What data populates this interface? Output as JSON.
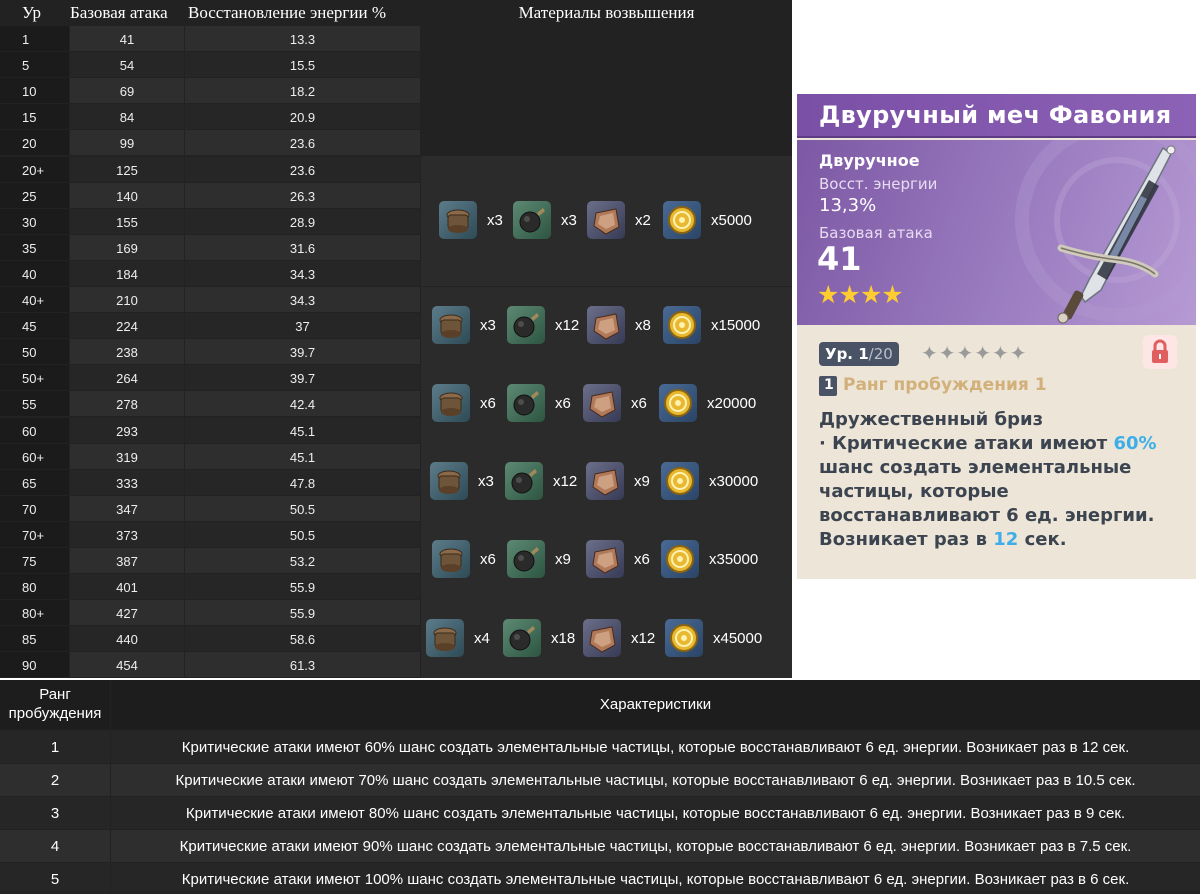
{
  "level_table": {
    "headers": {
      "level": "Ур",
      "base_atk": "Базовая атака",
      "energy": "Восстановление энергии %",
      "materials": "Материалы возвышения"
    },
    "rows": [
      {
        "level": "1",
        "atk": "41",
        "er": "13.3"
      },
      {
        "level": "5",
        "atk": "54",
        "er": "15.5"
      },
      {
        "level": "10",
        "atk": "69",
        "er": "18.2"
      },
      {
        "level": "15",
        "atk": "84",
        "er": "20.9"
      },
      {
        "level": "20",
        "atk": "99",
        "er": "23.6"
      },
      {
        "level": "20+",
        "atk": "125",
        "er": "23.6"
      },
      {
        "level": "25",
        "atk": "140",
        "er": "26.3"
      },
      {
        "level": "30",
        "atk": "155",
        "er": "28.9"
      },
      {
        "level": "35",
        "atk": "169",
        "er": "31.6"
      },
      {
        "level": "40",
        "atk": "184",
        "er": "34.3"
      },
      {
        "level": "40+",
        "atk": "210",
        "er": "34.3"
      },
      {
        "level": "45",
        "atk": "224",
        "er": "37"
      },
      {
        "level": "50",
        "atk": "238",
        "er": "39.7"
      },
      {
        "level": "50+",
        "atk": "264",
        "er": "39.7"
      },
      {
        "level": "55",
        "atk": "278",
        "er": "42.4"
      },
      {
        "level": "60",
        "atk": "293",
        "er": "45.1"
      },
      {
        "level": "60+",
        "atk": "319",
        "er": "45.1"
      },
      {
        "level": "65",
        "atk": "333",
        "er": "47.8"
      },
      {
        "level": "70",
        "atk": "347",
        "er": "50.5"
      },
      {
        "level": "70+",
        "atk": "373",
        "er": "50.5"
      },
      {
        "level": "75",
        "atk": "387",
        "er": "53.2"
      },
      {
        "level": "80",
        "atk": "401",
        "er": "55.9"
      },
      {
        "level": "80+",
        "atk": "427",
        "er": "55.9"
      },
      {
        "level": "85",
        "atk": "440",
        "er": "58.6"
      },
      {
        "level": "90",
        "atk": "454",
        "er": "61.3"
      }
    ],
    "ascension": [
      {
        "items": [
          {
            "icon": "domain-material-icon",
            "count": "x3"
          },
          {
            "icon": "elite-drop-icon",
            "count": "x3"
          },
          {
            "icon": "common-drop-icon",
            "count": "x2"
          },
          {
            "icon": "mora-coin-icon",
            "count": "x5000"
          }
        ]
      },
      {
        "items": [
          {
            "icon": "domain-material-icon",
            "count": "x3"
          },
          {
            "icon": "elite-drop-icon",
            "count": "x12"
          },
          {
            "icon": "common-drop-icon",
            "count": "x8"
          },
          {
            "icon": "mora-coin-icon",
            "count": "x15000"
          }
        ]
      },
      {
        "items": [
          {
            "icon": "domain-material-icon",
            "count": "x6"
          },
          {
            "icon": "elite-drop-icon",
            "count": "x6"
          },
          {
            "icon": "common-drop-icon",
            "count": "x6"
          },
          {
            "icon": "mora-coin-icon",
            "count": "x20000"
          }
        ]
      },
      {
        "items": [
          {
            "icon": "domain-material-icon",
            "count": "x3"
          },
          {
            "icon": "elite-drop-icon",
            "count": "x12"
          },
          {
            "icon": "common-drop-icon",
            "count": "x9"
          },
          {
            "icon": "mora-coin-icon",
            "count": "x30000"
          }
        ]
      },
      {
        "items": [
          {
            "icon": "domain-material-icon",
            "count": "x6"
          },
          {
            "icon": "elite-drop-icon",
            "count": "x9"
          },
          {
            "icon": "common-drop-icon",
            "count": "x6"
          },
          {
            "icon": "mora-coin-icon",
            "count": "x35000"
          }
        ]
      },
      {
        "items": [
          {
            "icon": "domain-material-icon",
            "count": "x4"
          },
          {
            "icon": "elite-drop-icon",
            "count": "x18"
          },
          {
            "icon": "common-drop-icon",
            "count": "x12"
          },
          {
            "icon": "mora-coin-icon",
            "count": "x45000"
          }
        ]
      }
    ]
  },
  "card": {
    "title": "Двуручный меч Фавония",
    "type": "Двуручное",
    "substat_label": "Восст. энергии",
    "substat_value": "13,3%",
    "atk_label": "Базовая атака",
    "atk_value": "41",
    "stars": "★★★★",
    "level_prefix": "Ур. 1",
    "level_suffix": "/20",
    "ascension_stars": "✦✦✦✦✦✦",
    "refine_rank": "1",
    "refine_label": "Ранг пробуждения 1",
    "passive_name": "Дружественный бриз",
    "passive_line1_a": "· Критические атаки имеют ",
    "passive_line1_b": "60%",
    "passive_line2": "шанс создать элементальные",
    "passive_line3": "частицы, которые",
    "passive_line4": "восстанавливают 6 ед. энергии.",
    "passive_line5_a": "Возникает раз в ",
    "passive_line5_b": "12",
    "passive_line5_c": " сек.",
    "colors": {
      "accent": "#3daee9",
      "purple": "#8c62b6",
      "gold": "#ffcc32",
      "ink": "#3c4450"
    }
  },
  "refinement_table": {
    "head_rank": "Ранг\nпробуждения",
    "head_rank_l1": "Ранг",
    "head_rank_l2": "пробуждения",
    "head_desc": "Характеристики",
    "rows": [
      {
        "rank": "1",
        "text": "Критические атаки имеют 60% шанс создать элементальные частицы, которые восстанавливают 6 ед. энергии. Возникает раз в 12 сек."
      },
      {
        "rank": "2",
        "text": "Критические атаки имеют 70% шанс создать элементальные частицы, которые восстанавливают 6 ед. энергии. Возникает раз в 10.5 сек."
      },
      {
        "rank": "3",
        "text": "Критические атаки имеют 80% шанс создать элементальные частицы, которые восстанавливают 6 ед. энергии. Возникает раз в 9 сек."
      },
      {
        "rank": "4",
        "text": "Критические атаки имеют 90% шанс создать элементальные частицы, которые восстанавливают 6 ед. энергии. Возникает раз в 7.5 сек."
      },
      {
        "rank": "5",
        "text": "Критические атаки имеют 100% шанс создать элементальные частицы, которые восстанавливают 6 ед. энергии. Возникает раз в 6 сек."
      }
    ]
  }
}
